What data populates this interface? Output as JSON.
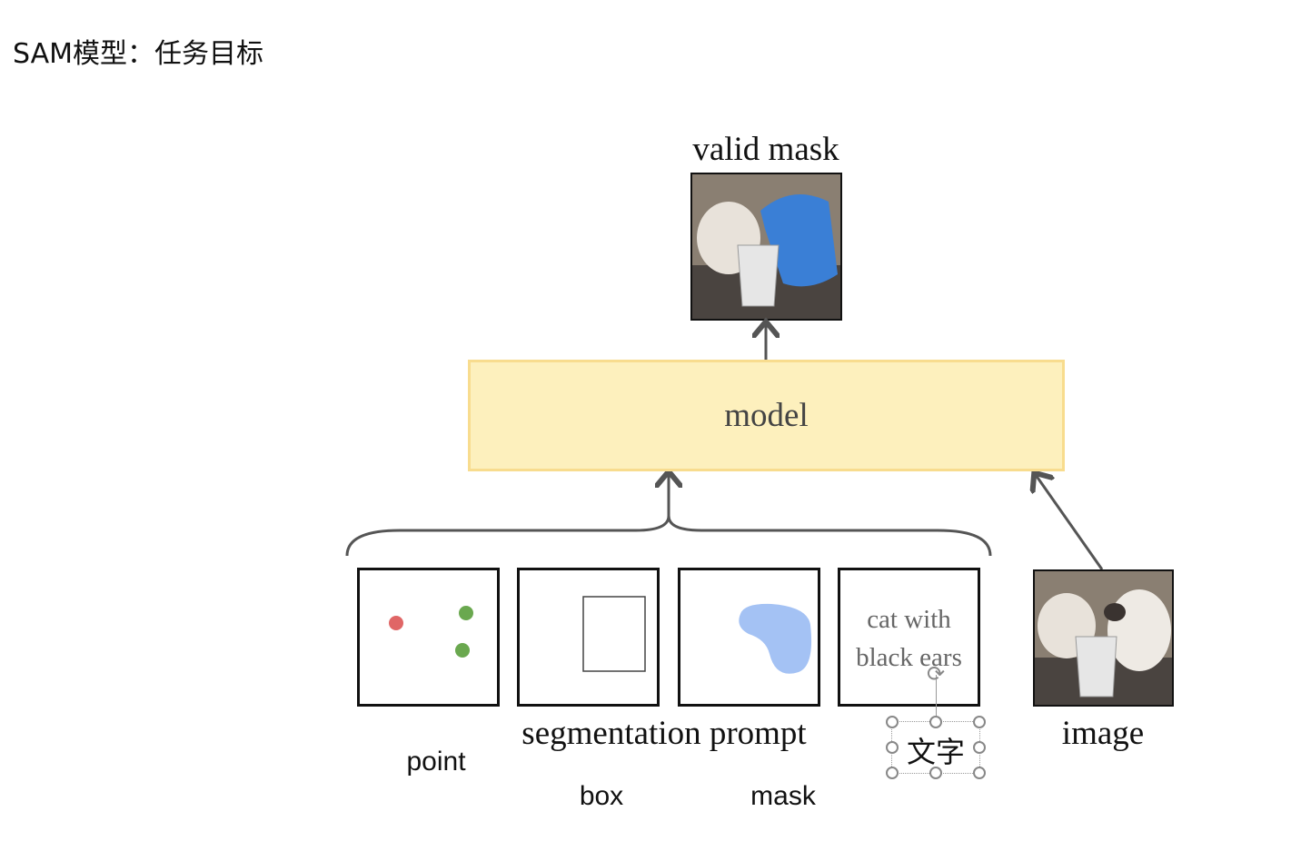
{
  "slide": {
    "title": "SAM模型：任务目标",
    "diagram": {
      "output_label": "valid mask",
      "model_label": "model",
      "prompt_group_label": "segmentation prompt",
      "prompt_text": "cat with black ears",
      "prompt_text_line1": "cat with",
      "prompt_text_line2": "black ears",
      "image_label": "image",
      "annotations": {
        "point": "point",
        "box": "box",
        "mask": "mask",
        "text": "文字"
      }
    }
  },
  "colors": {
    "model_fill": "#fdf0bd",
    "model_border": "#f8dc8e",
    "point_red": "#e06666",
    "point_green": "#6aa84f",
    "mask_blue": "#a4c2f4"
  }
}
